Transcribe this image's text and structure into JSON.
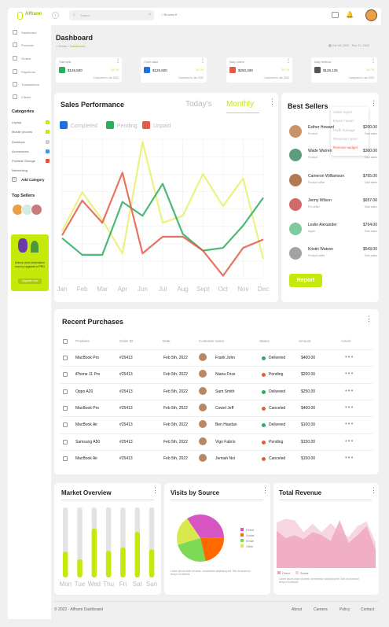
{
  "brand": {
    "name": "Afframi",
    "accent": "#c5e90b"
  },
  "topbar": {
    "search_placeholder": "Search",
    "browse_label": "Browse"
  },
  "sidebar": {
    "items": [
      {
        "label": "Dashboard",
        "icon": "grid-icon"
      },
      {
        "label": "Products",
        "icon": "box-icon"
      },
      {
        "label": "Orders",
        "icon": "cart-icon"
      },
      {
        "label": "Payments",
        "icon": "card-icon"
      },
      {
        "label": "Transactions",
        "icon": "exchange-icon"
      },
      {
        "label": "Clients",
        "icon": "user-icon"
      }
    ],
    "categories_title": "Categories",
    "categories": [
      {
        "label": "Laptop",
        "color": "#c5e90b"
      },
      {
        "label": "Mobile phones",
        "color": "#c5e90b"
      },
      {
        "label": "Desktops",
        "color": "#cccccc"
      },
      {
        "label": "Accessories",
        "color": "#4a90e2"
      },
      {
        "label": "Portable Storage",
        "color": "#e94b3c"
      },
      {
        "label": "Networking",
        "color": ""
      }
    ],
    "add_category": "Add Category",
    "top_sellers": "Top Sellers",
    "promo": {
      "text": "Unlock more information now by Upgrade to PRO",
      "button": "Upgrade now"
    }
  },
  "header": {
    "title": "Dashboard",
    "breadcrumb_home": "Home",
    "breadcrumb_current": "Dashboard",
    "date_range": "Oct 18, 2022 - Nov 11, 2022"
  },
  "stats": [
    {
      "label": "Total sells",
      "value": "$126,500",
      "pct": "34.7%",
      "compare": "Compared to Jan 2022",
      "color": "#2eab5e",
      "icon": "dollar-icon"
    },
    {
      "label": "Order value",
      "value": "$126,500",
      "pct": "34.7%",
      "compare": "Compared to Jan 2022",
      "color": "#1f6fe0",
      "icon": "gift-icon"
    },
    {
      "label": "Daily orders",
      "value": "$250,200",
      "pct": "34.7%",
      "compare": "Compared to Jan 2022",
      "color": "#e35a4a",
      "icon": "bag-icon"
    },
    {
      "label": "Daily revenue",
      "value": "$126,125",
      "pct": "34.7%",
      "compare": "Compared to Jan 2022",
      "color": "#555555",
      "icon": "wallet-icon"
    }
  ],
  "sales": {
    "title": "Sales Performance",
    "tab_today": "Today's",
    "tab_monthly": "Monthly",
    "chart_data": {
      "type": "line",
      "categories": [
        "Jan",
        "Feb",
        "Mar",
        "Apr",
        "Jun",
        "Jul",
        "Aug",
        "Sept",
        "Oct",
        "Nov",
        "Dec"
      ],
      "ylim": [
        0,
        100
      ],
      "series": [
        {
          "name": "Completed",
          "color": "#1f6fe0",
          "values": [
            30,
            22,
            22,
            38,
            30,
            58,
            40,
            28,
            10,
            28,
            50
          ]
        },
        {
          "name": "Pending",
          "color": "#2eab5e",
          "values": [
            29,
            17,
            17,
            55,
            45,
            68,
            32,
            20,
            22,
            38,
            58
          ]
        },
        {
          "name": "Unpaid",
          "color": "#e35a4a",
          "values": [
            31,
            56,
            40,
            76,
            18,
            30,
            30,
            20,
            2,
            22,
            28
          ]
        }
      ],
      "extra_series": [
        {
          "color": "#e8f06a",
          "values": [
            34,
            62,
            42,
            18,
            98,
            40,
            45,
            75,
            52,
            72,
            14
          ]
        }
      ]
    }
  },
  "best_sellers": {
    "title": "Best Sellers",
    "menu": [
      "Sales report",
      "Export report",
      "Profit manage",
      "Revenue report",
      "Remove widget"
    ],
    "items": [
      {
        "name": "Esther Howard",
        "sub": "Product",
        "price": "$200.00",
        "sub2": "Total sales",
        "color": "#c89466"
      },
      {
        "name": "Wade Warren",
        "sub": "Product",
        "price": "$300.00",
        "sub2": "Total sales",
        "color": "#5e9c7e"
      },
      {
        "name": "Cameron Williamson",
        "sub": "Product seller",
        "price": "$765.00",
        "sub2": "Total sales",
        "color": "#b17a55"
      },
      {
        "name": "Jenny Wilson",
        "sub": "Pro seller",
        "price": "$657.00",
        "sub2": "Total sales",
        "color": "#d16b6b"
      },
      {
        "name": "Leslie Alexander",
        "sub": "Apple",
        "price": "$764.00",
        "sub2": "Total sales",
        "color": "#7fc9a0"
      },
      {
        "name": "Kristin Watson",
        "sub": "Product seller",
        "price": "$543.00",
        "sub2": "Total sales",
        "color": "#a3a3a3"
      }
    ],
    "report_button": "Report"
  },
  "purchases": {
    "title": "Recent Purchases",
    "columns": [
      "Products",
      "Order ID",
      "Date",
      "Customer name",
      "Status",
      "Amount",
      "Action"
    ],
    "rows": [
      {
        "product": "MacBook Pro",
        "order": "#25413",
        "date": "Feb 5th, 2022",
        "customer": "Frank John",
        "status": "Delivered",
        "status_color": "#2eab5e",
        "amount": "$400.00"
      },
      {
        "product": "iPhone 11 Pro",
        "order": "#25413",
        "date": "Feb 5th, 2022",
        "customer": "Niana Friss",
        "status": "Pending",
        "status_color": "#e35a4a",
        "amount": "$200.00"
      },
      {
        "product": "Oppo A20",
        "order": "#25413",
        "date": "Feb 5th, 2022",
        "customer": "Sam Smith",
        "status": "Delivered",
        "status_color": "#2eab5e",
        "amount": "$250.00"
      },
      {
        "product": "MacBook Pro",
        "order": "#25413",
        "date": "Feb 5th, 2022",
        "customer": "Cowel Jeff",
        "status": "Canceled",
        "status_color": "#e35a4a",
        "amount": "$400.00"
      },
      {
        "product": "MacBook Air",
        "order": "#25413",
        "date": "Feb 5th, 2022",
        "customer": "Ben Hasdan",
        "status": "Delivered",
        "status_color": "#2eab5e",
        "amount": "$100.00"
      },
      {
        "product": "Samsung A50",
        "order": "#25413",
        "date": "Feb 5th, 2022",
        "customer": "Vigo Fabrio",
        "status": "Pending",
        "status_color": "#e35a4a",
        "amount": "$150.00"
      },
      {
        "product": "MacBook Air",
        "order": "#25413",
        "date": "Feb 5th, 2022",
        "customer": "Jemiah Noi",
        "status": "Canceled",
        "status_color": "#e35a4a",
        "amount": "$150.00"
      }
    ]
  },
  "market": {
    "title": "Market Overview",
    "chart_data": {
      "type": "bar",
      "categories": [
        "Mon",
        "Tue",
        "Wed",
        "Thu",
        "Fri",
        "Sat",
        "Sun"
      ],
      "values": [
        37,
        26,
        70,
        38,
        43,
        65,
        40
      ],
      "ylim": [
        0,
        100
      ]
    }
  },
  "visits": {
    "title": "Visits by Source",
    "chart_data": {
      "type": "pie",
      "labels": [
        "Direct",
        "Social",
        "Email",
        "Other"
      ],
      "values": [
        34,
        22,
        24,
        20
      ],
      "colors": [
        "#d754c3",
        "#ff6a00",
        "#7ed957",
        "#d9e84d"
      ]
    },
    "caption": "Lorem ipsum dolor sit amet, consectetur adipiscing elit. Sed do eiusmod tempor incididunt."
  },
  "revenue": {
    "title": "Total Revenue",
    "chart_data": {
      "type": "area",
      "series": [
        {
          "name": "Direct",
          "color": "#f0a8c0",
          "values": [
            62,
            50,
            55,
            48,
            60,
            55,
            45,
            80,
            42,
            55,
            70,
            30
          ]
        },
        {
          "name": "Social",
          "color": "#f5d0dc",
          "values": [
            76,
            82,
            80,
            60,
            74,
            60,
            75,
            60,
            52,
            70,
            78,
            42
          ]
        }
      ]
    },
    "caption": "Lorem ipsum dolor sit amet, consectetur adipiscing elit. Sed do eiusmod tempor incididunt."
  },
  "footer": {
    "copyright": "© 2022 - Afframi Dashboard",
    "links": [
      "About",
      "Careers",
      "Policy",
      "Contact"
    ]
  }
}
